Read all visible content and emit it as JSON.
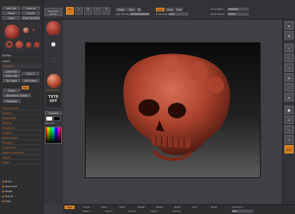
{
  "toolbar": {
    "brush_top_left": "Brush Top",
    "projection_master": "Projection Master",
    "mode_buttons": [
      "Edit",
      "Draw",
      "Move",
      "Scale",
      "Rotate"
    ],
    "mrgb": "Mrgb",
    "rgb": "Rgb",
    "m": "M",
    "zadd": "Zadd",
    "zsub": "Zsub",
    "zcut": "Zcut",
    "focal_shift_label": "Focal Shift 0",
    "draw_size_label": "Draw Size 64",
    "rgb_intensity_label": "Rgb Intensity 100",
    "z_intensity_label": "Z Intensity 25"
  },
  "left_panel": {
    "top_buttons": [
      "Load Tool",
      "Save As",
      "Import",
      "Export",
      "Clone",
      "Make PolyMesh3D"
    ],
    "subtool_header": "SubTool",
    "layers_header": "Layers",
    "geometry_header": "Geometry",
    "geometry_items": [
      "Lower Res",
      "Higher Res",
      "Del Lower",
      "Del Higher",
      "Divide",
      "Reconstruct Subdiv"
    ],
    "edgeloop": "EdgeLoop",
    "smt": "Smt",
    "sdiv": "SDiv 5",
    "menu_items": [
      "Geometry HD",
      "Preview",
      "Deformation",
      "Masking",
      "Polygroups",
      "Contact",
      "Morph Target",
      "Polypaint",
      "Unified Skin",
      "Display Properties",
      "Import",
      "Export"
    ],
    "bottom_items": [
      "Brush",
      "Document",
      "Stroke",
      "Texture",
      "Color"
    ]
  },
  "tool_panel": {
    "material_label": "SkinShade4",
    "texture_label": "Texture Off",
    "txtr_text": "TXTR OFF",
    "gradient": "Gradient",
    "switch_color": "SwitchColor",
    "alternate": "Alternate",
    "color_label": "Color"
  },
  "bottom_bar": {
    "items": [
      "Edit",
      "Frame",
      "Move",
      "Scale",
      "Rotate",
      "Transp",
      "Ghost",
      "Solo",
      "Xpose"
    ],
    "value_labels": [
      "Persp 0",
      "Floor 0",
      "Local 0",
      "Lsym 0",
      "Quick 0",
      "Dynamic 0"
    ]
  },
  "right_bar": {
    "items": [
      "BPR",
      "SPix 3",
      "Scroll",
      "Zoom",
      "Actual",
      "AAHalf",
      "Persp",
      "Floor",
      "Local",
      "Frame",
      "Move",
      "Scale",
      "Rotate",
      "PolyF"
    ]
  },
  "colors": {
    "accent": "#d07a1c",
    "background": "#3b3b3f",
    "panel": "#2b2b2e",
    "skull": "#a8402c"
  }
}
